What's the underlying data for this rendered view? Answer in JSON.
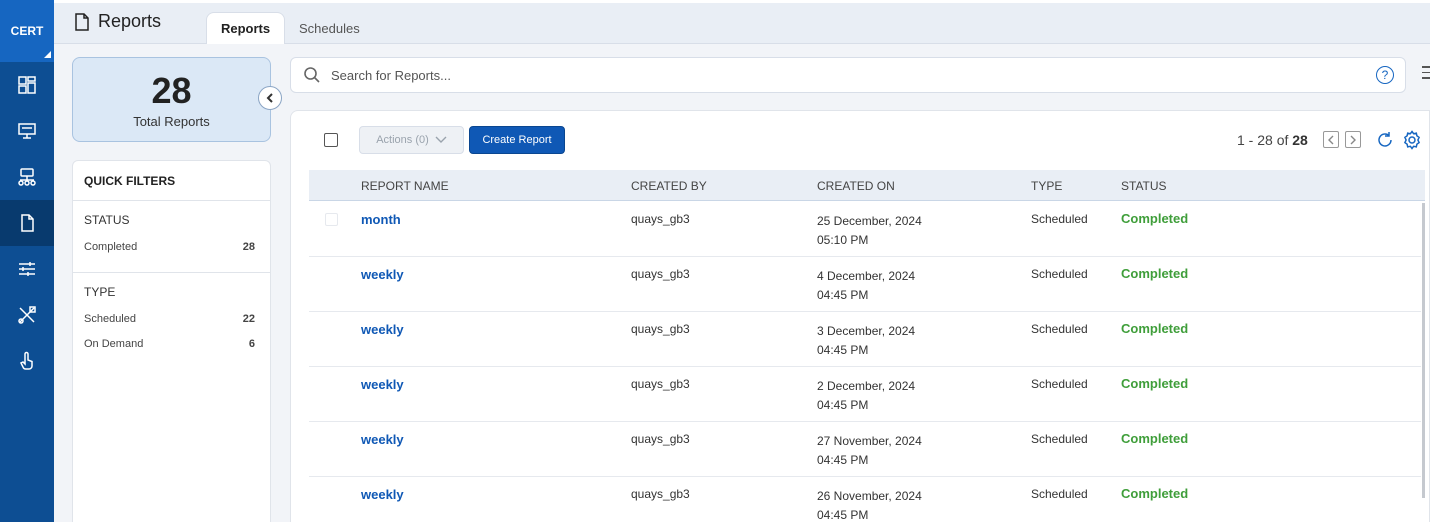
{
  "brand": {
    "label": "CERT"
  },
  "nav": {
    "items": [
      {
        "name": "dashboard-icon",
        "active": false
      },
      {
        "name": "monitor-icon",
        "active": false
      },
      {
        "name": "network-icon",
        "active": false
      },
      {
        "name": "report-icon",
        "active": true
      },
      {
        "name": "sliders-icon",
        "active": false
      },
      {
        "name": "tools-icon",
        "active": false
      },
      {
        "name": "hand-pointer-icon",
        "active": false
      }
    ]
  },
  "header": {
    "title": "Reports",
    "tabs": [
      {
        "label": "Reports",
        "active": true
      },
      {
        "label": "Schedules",
        "active": false
      }
    ]
  },
  "summary": {
    "count": "28",
    "label": "Total Reports"
  },
  "quick_filters": {
    "title": "QUICK FILTERS",
    "status": {
      "heading": "STATUS",
      "items": [
        {
          "label": "Completed",
          "count": "28"
        }
      ]
    },
    "type": {
      "heading": "TYPE",
      "items": [
        {
          "label": "Scheduled",
          "count": "22"
        },
        {
          "label": "On Demand",
          "count": "6"
        }
      ]
    }
  },
  "search": {
    "placeholder": "Search for Reports...",
    "help_label": "?"
  },
  "toolbar": {
    "actions_label": "Actions (0)",
    "create_label": "Create Report",
    "pager_range": "1 - 28 of ",
    "pager_total": "28"
  },
  "table": {
    "columns": [
      "REPORT NAME",
      "CREATED BY",
      "CREATED ON",
      "TYPE",
      "STATUS"
    ],
    "rows": [
      {
        "name": "month",
        "created_by": "quays_gb3",
        "date": "25 December, 2024",
        "time": "05:10 PM",
        "type": "Scheduled",
        "status": "Completed"
      },
      {
        "name": "weekly",
        "created_by": "quays_gb3",
        "date": "4 December, 2024",
        "time": "04:45 PM",
        "type": "Scheduled",
        "status": "Completed"
      },
      {
        "name": "weekly",
        "created_by": "quays_gb3",
        "date": "3 December, 2024",
        "time": "04:45 PM",
        "type": "Scheduled",
        "status": "Completed"
      },
      {
        "name": "weekly",
        "created_by": "quays_gb3",
        "date": "2 December, 2024",
        "time": "04:45 PM",
        "type": "Scheduled",
        "status": "Completed"
      },
      {
        "name": "weekly",
        "created_by": "quays_gb3",
        "date": "27 November, 2024",
        "time": "04:45 PM",
        "type": "Scheduled",
        "status": "Completed"
      },
      {
        "name": "weekly",
        "created_by": "quays_gb3",
        "date": "26 November, 2024",
        "time": "04:45 PM",
        "type": "Scheduled",
        "status": "Completed"
      }
    ]
  },
  "colors": {
    "nav_bg": "#0d4e93",
    "brand_bg": "#1666c1",
    "link": "#0f58b5",
    "status_completed": "#3f9e3a"
  }
}
